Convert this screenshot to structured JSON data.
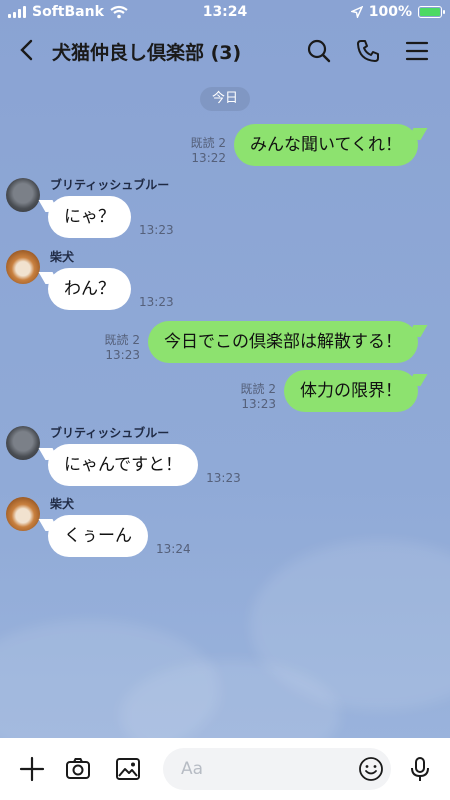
{
  "status_bar": {
    "carrier": "SoftBank",
    "time": "13:24",
    "battery": "100%",
    "battery_level": 1.0
  },
  "header": {
    "title": "犬猫仲良し倶楽部 (3)"
  },
  "chat": {
    "date_chip": "今日",
    "messages": [
      {
        "side": "right",
        "text": "みんな聞いてくれ！",
        "read": "既読 2",
        "time": "13:22"
      },
      {
        "side": "left",
        "sender": "ブリティッシュブルー",
        "avatar": "cat-avatar",
        "text": "にゃ？",
        "time": "13:23"
      },
      {
        "side": "left",
        "sender": "柴犬",
        "avatar": "dog-avatar",
        "text": "わん？",
        "time": "13:23"
      },
      {
        "side": "right",
        "text": "今日でこの倶楽部は解散する！",
        "read": "既読 2",
        "time": "13:23"
      },
      {
        "side": "right",
        "text": "体力の限界！",
        "read": "既読 2",
        "time": "13:23"
      },
      {
        "side": "left",
        "sender": "ブリティッシュブルー",
        "avatar": "cat-avatar",
        "text": "にゃんですと！",
        "time": "13:23"
      },
      {
        "side": "left",
        "sender": "柴犬",
        "avatar": "dog-avatar",
        "text": "くぅーん",
        "time": "13:24"
      }
    ]
  },
  "input_bar": {
    "placeholder": "Aa"
  },
  "colors": {
    "background": "#8fa9d6",
    "my_bubble": "#8de26f",
    "their_bubble": "#ffffff"
  }
}
